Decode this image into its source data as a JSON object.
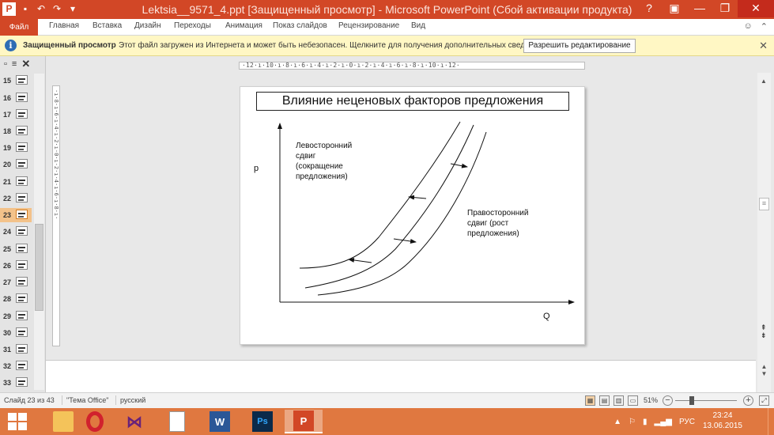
{
  "window": {
    "title": "Lektsia__9571_4.ppt [Защищенный просмотр]  -  Microsoft PowerPoint (Сбой активации продукта)",
    "app_icon": "P"
  },
  "ribbon": {
    "tabs": [
      "Файл",
      "Главная",
      "Вставка",
      "Дизайн",
      "Переходы",
      "Анимация",
      "Показ слайдов",
      "Рецензирование",
      "Вид"
    ]
  },
  "protected_view": {
    "title": "Защищенный просмотр",
    "message": "Этот файл загружен из Интернета и может быть небезопасен. Щелкните для получения дополнительных сведений.",
    "button": "Разрешить редактирование"
  },
  "thumbnails": {
    "items": [
      "15",
      "16",
      "17",
      "18",
      "19",
      "20",
      "21",
      "22",
      "23",
      "24",
      "25",
      "26",
      "27",
      "28",
      "29",
      "30",
      "31",
      "32",
      "33"
    ],
    "active": "23"
  },
  "ruler": {
    "horizontal": "·12·ı·10·ı·8·ı·6·ı·4·ı·2·ı·0·ı·2·ı·4·ı·6·ı·8·ı·10·ı·12·",
    "vertical": "·ı·8·ı·6·ı·4·ı·2·ı·0·ı·2·ı·4·ı·6·ı·8·ı·"
  },
  "slide": {
    "title": "Влияние неценовых факторов предложения",
    "y_axis_label": "p",
    "x_axis_label": "Q",
    "left_shift_label": [
      "Левосторонний",
      "сдвиг",
      "(сокращение",
      "предложения)"
    ],
    "right_shift_label": [
      "Правосторонний",
      "сдвиг (рост",
      "предложения)"
    ]
  },
  "status": {
    "slide_info": "Слайд 23 из 43",
    "theme": "\"Тема Office\"",
    "language": "русский",
    "zoom": "51%"
  },
  "taskbar": {
    "apps": [
      "explorer",
      "opera",
      "visual-studio",
      "document",
      "word",
      "photoshop",
      "powerpoint"
    ],
    "icon_letters": {
      "word": "W",
      "photoshop": "Ps",
      "powerpoint": "P"
    },
    "tray_language": "РУС",
    "time": "23:24",
    "date": "13.06.2015"
  },
  "colors": {
    "accent": "#d24726",
    "taskbar": "#e07840",
    "protected_bar": "#fff7c4"
  }
}
